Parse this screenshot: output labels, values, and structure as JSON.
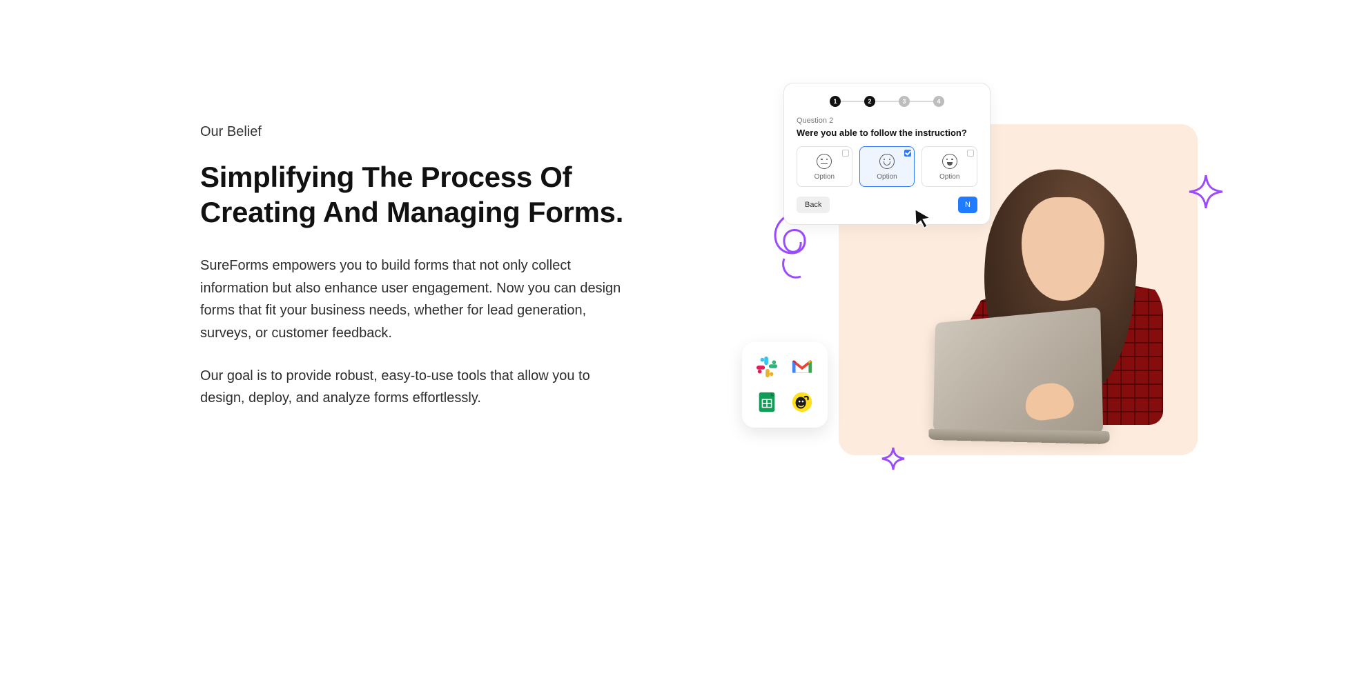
{
  "eyebrow": "Our Belief",
  "headline": "Simplifying The Process Of Creating And Managing Forms.",
  "paragraph1": "SureForms empowers you to build forms that not only collect information but also enhance user engagement. Now you can design forms that fit your business needs, whether for lead generation, surveys, or customer feedback.",
  "paragraph2": "Our goal is to provide robust, easy-to-use tools that allow you to design, deploy, and analyze forms effortlessly.",
  "form": {
    "steps": [
      "1",
      "2",
      "3",
      "4"
    ],
    "question_label": "Question 2",
    "question_text": "Were you able to follow the instruction?",
    "options": [
      {
        "label": "Option",
        "face": "neutral",
        "selected": false
      },
      {
        "label": "Option",
        "face": "happy",
        "selected": true
      },
      {
        "label": "Option",
        "face": "laugh",
        "selected": false
      }
    ],
    "back": "Back",
    "next": "N"
  },
  "integrations": [
    "slack",
    "gmail",
    "sheets",
    "mailchimp"
  ]
}
